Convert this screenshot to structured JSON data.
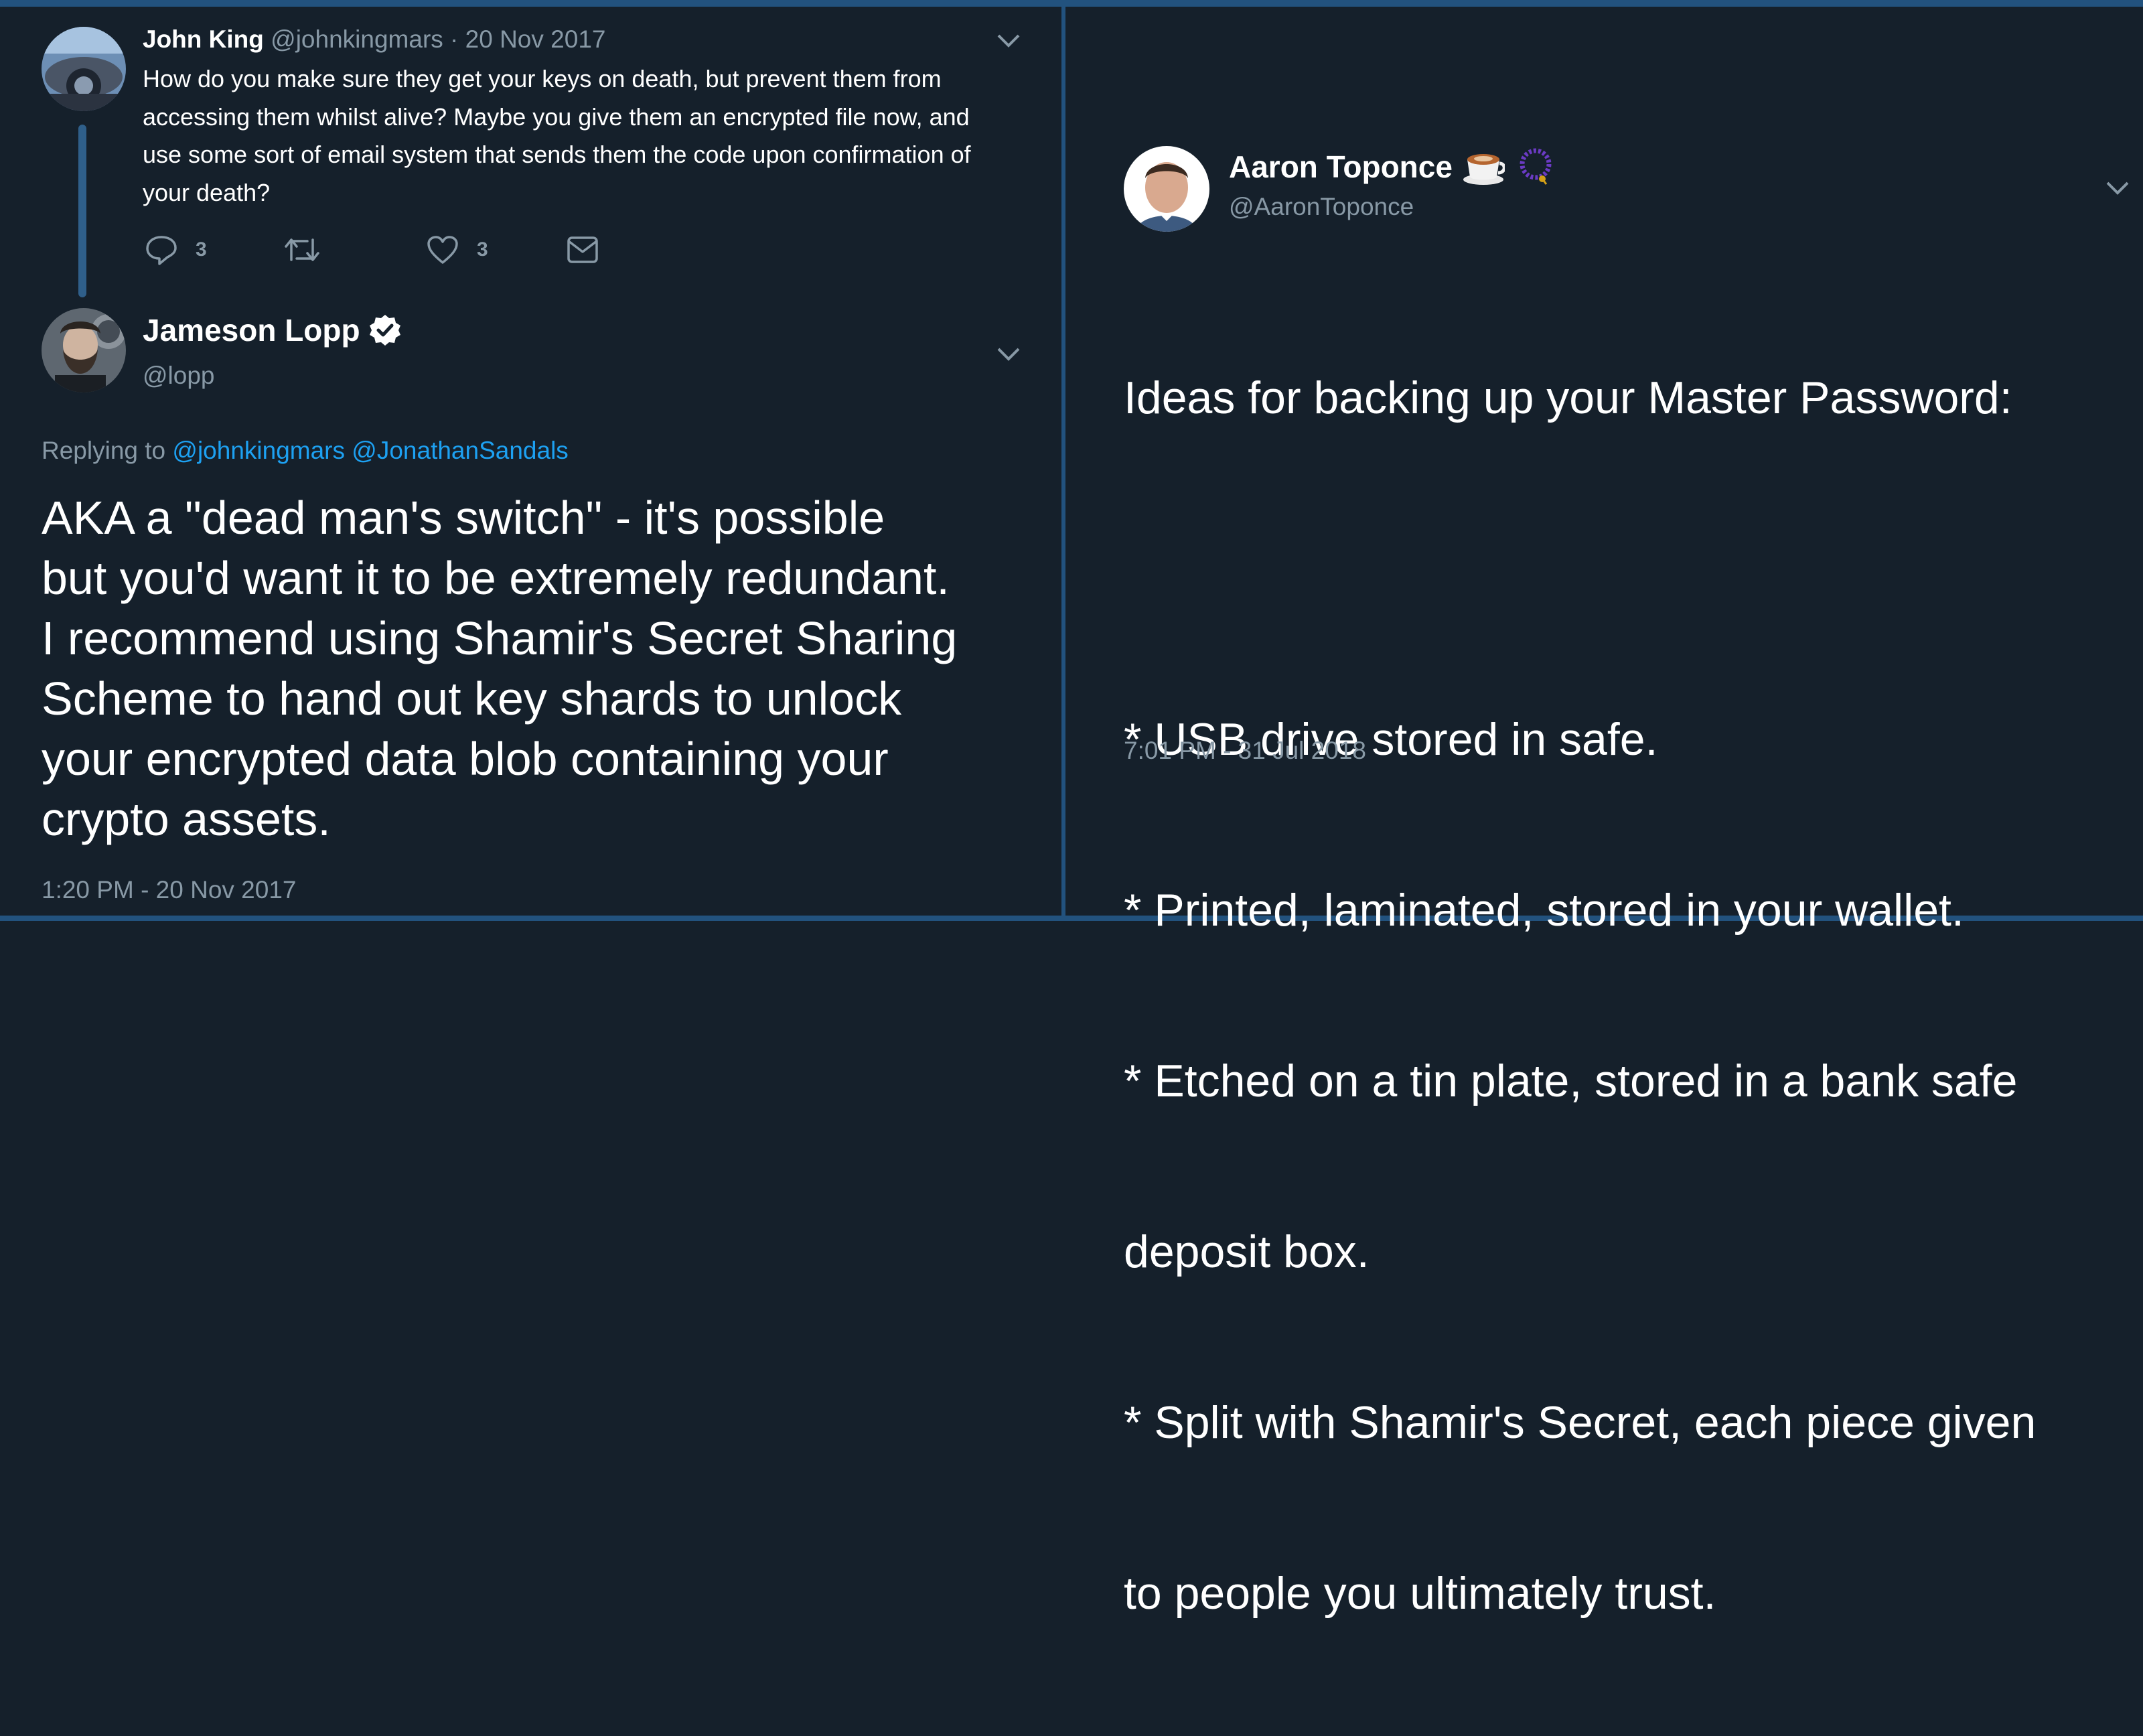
{
  "left": {
    "parent_tweet": {
      "author_name": "John King",
      "handle": "@johnkingmars",
      "date": "· 20 Nov 2017",
      "text_lines": [
        "How do you make sure they get your keys on death, but prevent them from",
        "accessing them whilst alive? Maybe you give them an encrypted file now, and",
        "use some sort of email system that sends them the code upon confirmation of",
        "your death?"
      ],
      "reply_count": "3",
      "like_count": "3",
      "icons": [
        "reply-icon",
        "retweet-icon",
        "like-icon",
        "message-icon",
        "chevron-down-icon"
      ]
    },
    "main_tweet": {
      "author_name": "Jameson Lopp",
      "handle": "@lopp",
      "replying_prefix": "Replying to",
      "replying_to": [
        "@johnkingmars",
        "@JonathanSandals"
      ],
      "text_lines": [
        "AKA a \"dead man's switch\" - it's possible",
        "but you'd want it to be extremely redundant.",
        "I recommend using Shamir's Secret Sharing",
        "Scheme to hand out key shards to unlock",
        "your encrypted data blob containing your",
        "crypto assets."
      ],
      "timestamp": "1:20 PM - 20 Nov 2017",
      "icons": [
        "verified-badge-icon",
        "chevron-down-icon"
      ]
    }
  },
  "right": {
    "tweet": {
      "author_name": "Aaron Toponce",
      "handle": "@AaronToponce",
      "emoji_icons": [
        "coffee-cup-icon",
        "prayer-beads-icon"
      ],
      "text_lines": [
        "Ideas for backing up your Master Password:",
        "",
        "* USB drive stored in safe.",
        "* Printed, laminated, stored in your wallet.",
        "* Etched on a tin plate, stored in a bank safe",
        "deposit box.",
        "* Split with Shamir's Secret, each piece given",
        "to people you ultimately trust."
      ],
      "timestamp": "7:01 PM - 31 Jul 2018"
    }
  },
  "colors": {
    "background": "#15202b",
    "divider": "#22527e",
    "muted_text": "#8899a6",
    "link": "#1da1f2",
    "thread_line": "#2f5f8a"
  }
}
